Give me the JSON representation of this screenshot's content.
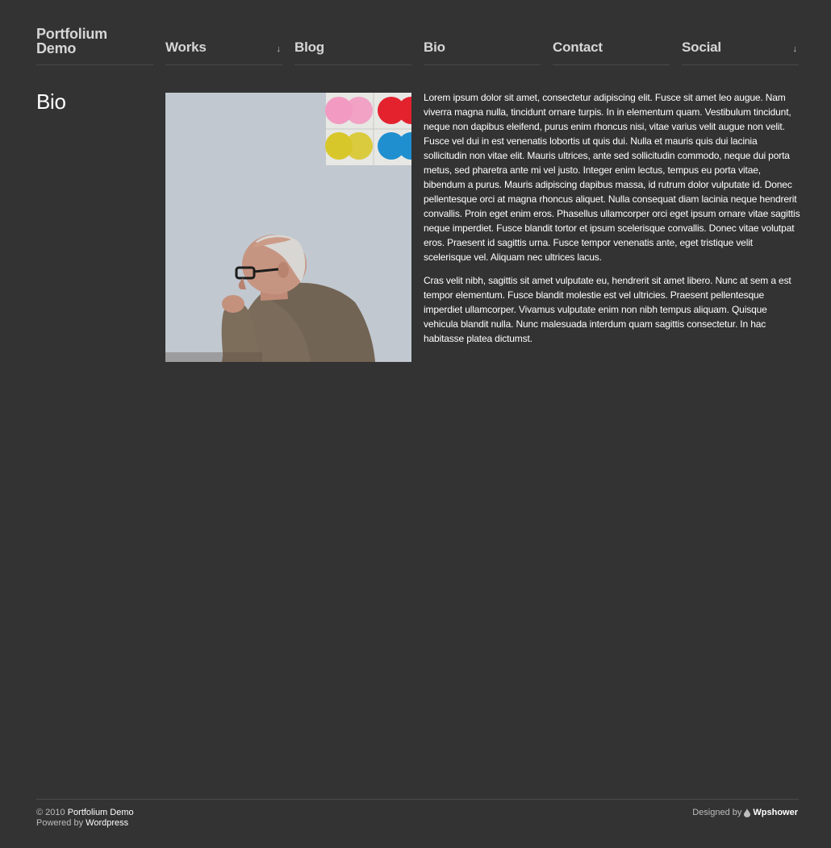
{
  "site": {
    "title_line1": "Portfolium",
    "title_line2": "Demo"
  },
  "nav": {
    "works": "Works",
    "blog": "Blog",
    "bio": "Bio",
    "contact": "Contact",
    "social": "Social",
    "dropdown_arrow": "↓"
  },
  "page": {
    "title": "Bio",
    "paragraphs": [
      "Lorem ipsum dolor sit amet, consectetur adipiscing elit. Fusce sit amet leo augue. Nam viverra magna nulla, tincidunt ornare turpis. In in elementum quam. Vestibulum tincidunt, neque non dapibus eleifend, purus enim rhoncus nisi, vitae varius velit augue non velit. Fusce vel dui in est venenatis lobortis ut quis dui. Nulla et mauris quis dui lacinia sollicitudin non vitae elit. Mauris ultrices, ante sed sollicitudin commodo, neque dui porta metus, sed pharetra ante mi vel justo. Integer enim lectus, tempus eu porta vitae, bibendum a purus. Mauris adipiscing dapibus massa, id rutrum dolor vulputate id. Donec pellentesque orci at magna rhoncus aliquet. Nulla consequat diam lacinia neque hendrerit convallis. Proin eget enim eros. Phasellus ullamcorper orci eget ipsum ornare vitae sagittis neque imperdiet. Fusce blandit tortor et ipsum scelerisque convallis. Donec vitae volutpat eros. Praesent id sagittis urna. Fusce tempor venenatis ante, eget tristique velit scelerisque vel. Aliquam nec ultrices lacus.",
      "Cras velit nibh, sagittis sit amet vulputate eu, hendrerit sit amet libero. Nunc at sem a est tempor elementum. Fusce blandit molestie est vel ultricies. Praesent pellentesque imperdiet ullamcorper. Vivamus vulputate enim non nibh tempus aliquam. Quisque vehicula blandit nulla. Nunc malesuada interdum quam sagittis consectetur. In hac habitasse platea dictumst."
    ]
  },
  "footer": {
    "copyright_prefix": "© 2010",
    "copyright_name": "Portfolium Demo",
    "powered_prefix": "Powered by",
    "powered_name": "Wordpress",
    "designed_prefix": "Designed by",
    "designed_name": "Wpshower"
  },
  "colors": {
    "background": "#333333",
    "nav_text": "#d6d6d6",
    "divider": "#4a4a4a"
  },
  "icons": {
    "dropdown": "down-arrow-icon",
    "designer": "drop-icon"
  }
}
